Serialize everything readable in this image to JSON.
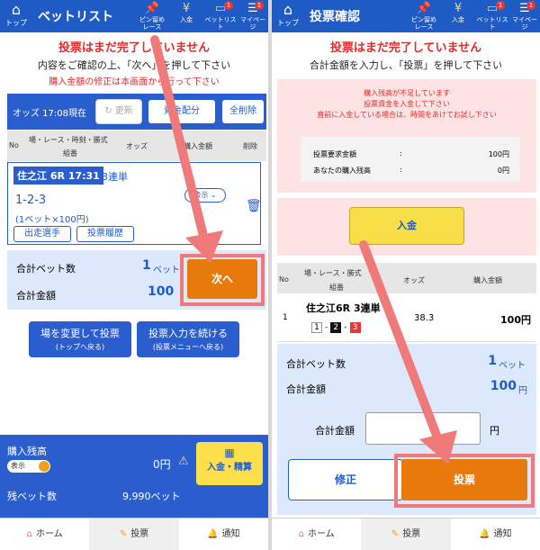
{
  "header_nav": [
    {
      "label1": "ピン留め",
      "label2": "レース",
      "icon": "pin-icon"
    },
    {
      "label1": "入金",
      "label2": "",
      "icon": "yen-icon"
    },
    {
      "label1": "ベットリスト",
      "label2": "",
      "icon": "ticket-icon",
      "badge": "1"
    },
    {
      "label1": "マイページ",
      "label2": "",
      "icon": "menu-icon",
      "badge": "1"
    }
  ],
  "home_label": "トップ",
  "left": {
    "title": "ベットリスト",
    "warn_title": "投票はまだ完了していません",
    "instruction": "内容をご確認の上、「次へ」を押して下さい",
    "warn_sub": "購入金額の修正は本画面から行って下さい",
    "odds_time": "オッズ 17:08現在",
    "refresh": "更新",
    "distribute": "資金配分",
    "delete_all": "全削除",
    "col_no": "No",
    "col_race": "場・レース・時刻・勝式",
    "col_group": "組番",
    "col_odds": "オッズ",
    "col_amount": "購入金額",
    "col_delete": "削除",
    "bet": {
      "race": "住之江 6R 17:31",
      "bet_type": "3連単",
      "combo": "1-2-3",
      "detail": "(1ベット×100円)",
      "show": "表示",
      "racers": "出走選手",
      "history": "投票履歴"
    },
    "total_bets_label": "合計ベット数",
    "total_bets_value": "1",
    "total_bets_unit": "ベット",
    "total_amount_label": "合計金額",
    "total_amount_value": "100",
    "next": "次へ",
    "change_venue": "場を変更して投票",
    "change_venue_sub": "(トップへ戻る)",
    "continue": "投票入力を続ける",
    "continue_sub": "(投票メニューへ戻る)",
    "balance_label": "購入残高",
    "toggle_label": "表示",
    "balance_value": "0円",
    "deposit_settle": "入金・精算",
    "remaining_bets_label": "残ベット数",
    "remaining_bets_value": "9,990ベット"
  },
  "right": {
    "title": "投票確認",
    "warn_title": "投票はまだ完了していません",
    "instruction": "合計金額を入力し、「投票」を押して下さい",
    "alert": [
      "購入残高が不足しています",
      "投票資金を入金して下さい",
      "直前に入金している場合は、時間をあけてお試し下さい"
    ],
    "required_label": "投票要求金額",
    "required_value": "100円",
    "balance_label": "あなたの購入残高",
    "balance_value": "0円",
    "colon": ":",
    "deposit": "入金",
    "col_no": "No",
    "col_race": "場・レース・勝式",
    "col_group": "組番",
    "col_odds": "オッズ",
    "col_amount": "購入金額",
    "row": {
      "no": "1",
      "race": "住之江6R 3連単",
      "n1": "1",
      "n2": "2",
      "n3": "3",
      "odds": "38.3",
      "amount": "100円"
    },
    "total_bets_label": "合計ベット数",
    "total_bets_value": "1",
    "total_bets_unit": "ベット",
    "total_amount_label": "合計金額",
    "total_amount_value": "100",
    "total_amount_unit": "円",
    "input_label": "合計金額",
    "input_unit": "円",
    "input_value": "",
    "fix": "修正",
    "vote": "投票"
  },
  "tabs": [
    {
      "label": "ホーム",
      "icon": "home-icon"
    },
    {
      "label": "投票",
      "icon": "vote-icon"
    },
    {
      "label": "通知",
      "icon": "bell-icon"
    }
  ],
  "colors": {
    "header": "#1f5bc4",
    "accent_orange": "#e87a0c",
    "highlight": "#f07a7a",
    "warning_red": "#e32b2b"
  }
}
